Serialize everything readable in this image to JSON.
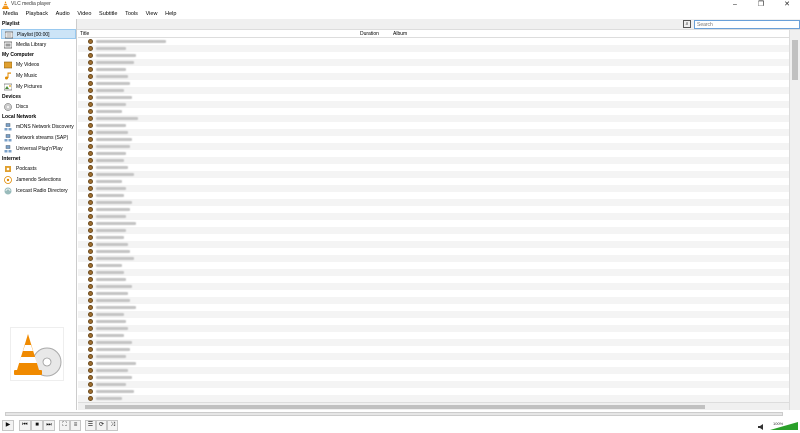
{
  "window": {
    "title": "VLC media player",
    "minimize": "–",
    "maximize": "❐",
    "close": "✕"
  },
  "menu": [
    "Media",
    "Playback",
    "Audio",
    "Video",
    "Subtitle",
    "Tools",
    "View",
    "Help"
  ],
  "search": {
    "placeholder": "Search"
  },
  "sidebar": {
    "playlist_header": "Playlist",
    "playlist_items": [
      {
        "label": "Playlist [00:00]",
        "icon": "playlist-icon"
      },
      {
        "label": "Media Library",
        "icon": "media-library-icon"
      }
    ],
    "computer_header": "My Computer",
    "computer_items": [
      {
        "label": "My Videos",
        "icon": "videos-icon"
      },
      {
        "label": "My Music",
        "icon": "music-icon"
      },
      {
        "label": "My Pictures",
        "icon": "pictures-icon"
      }
    ],
    "devices_header": "Devices",
    "devices_items": [
      {
        "label": "Discs",
        "icon": "disc-icon"
      }
    ],
    "network_header": "Local Network",
    "network_items": [
      {
        "label": "mDNS Network Discovery",
        "icon": "network-icon"
      },
      {
        "label": "Network streams (SAP)",
        "icon": "network-icon"
      },
      {
        "label": "Universal Plug'n'Play",
        "icon": "network-icon"
      }
    ],
    "internet_header": "Internet",
    "internet_items": [
      {
        "label": "Podcasts",
        "icon": "podcast-icon"
      },
      {
        "label": "Jamendo Selections",
        "icon": "jamendo-icon"
      },
      {
        "label": "Icecast Radio Directory",
        "icon": "icecast-icon"
      }
    ]
  },
  "playlist": {
    "columns": [
      "Title",
      "Duration",
      "Album"
    ],
    "row_count": 54
  },
  "controls": {
    "play": "▶",
    "prev": "⏮",
    "stop": "■",
    "next": "⏭",
    "fullscreen": "⛶",
    "extended": "≡",
    "playlist_toggle": "☰",
    "loop": "⟳",
    "random": "⤨",
    "volume_percent": "100%"
  },
  "colors": {
    "selection": "#cce4f7",
    "vlc_orange": "#f08a00",
    "search_border": "#6aa0d8"
  }
}
